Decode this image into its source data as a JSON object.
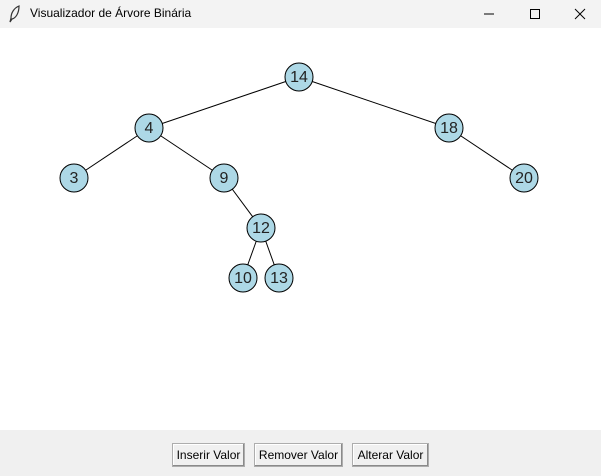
{
  "window": {
    "title": "Visualizador de Árvore Binária",
    "icon": "feather-icon",
    "controls": [
      "minimize-icon",
      "maximize-icon",
      "close-icon"
    ]
  },
  "tree": {
    "node_color": "#add8e6",
    "root": "14",
    "nodes": [
      {
        "id": "n14",
        "label": "14"
      },
      {
        "id": "n4",
        "label": "4"
      },
      {
        "id": "n18",
        "label": "18"
      },
      {
        "id": "n3",
        "label": "3"
      },
      {
        "id": "n9",
        "label": "9"
      },
      {
        "id": "n20",
        "label": "20"
      },
      {
        "id": "n12",
        "label": "12"
      },
      {
        "id": "n10",
        "label": "10"
      },
      {
        "id": "n13",
        "label": "13"
      }
    ],
    "edges": [
      [
        "14",
        "4"
      ],
      [
        "14",
        "18"
      ],
      [
        "4",
        "3"
      ],
      [
        "4",
        "9"
      ],
      [
        "18",
        "20"
      ],
      [
        "9",
        "12"
      ],
      [
        "12",
        "10"
      ],
      [
        "12",
        "13"
      ]
    ]
  },
  "buttons": {
    "insert": "Inserir Valor",
    "remove": "Remover Valor",
    "alter": "Alterar Valor"
  }
}
